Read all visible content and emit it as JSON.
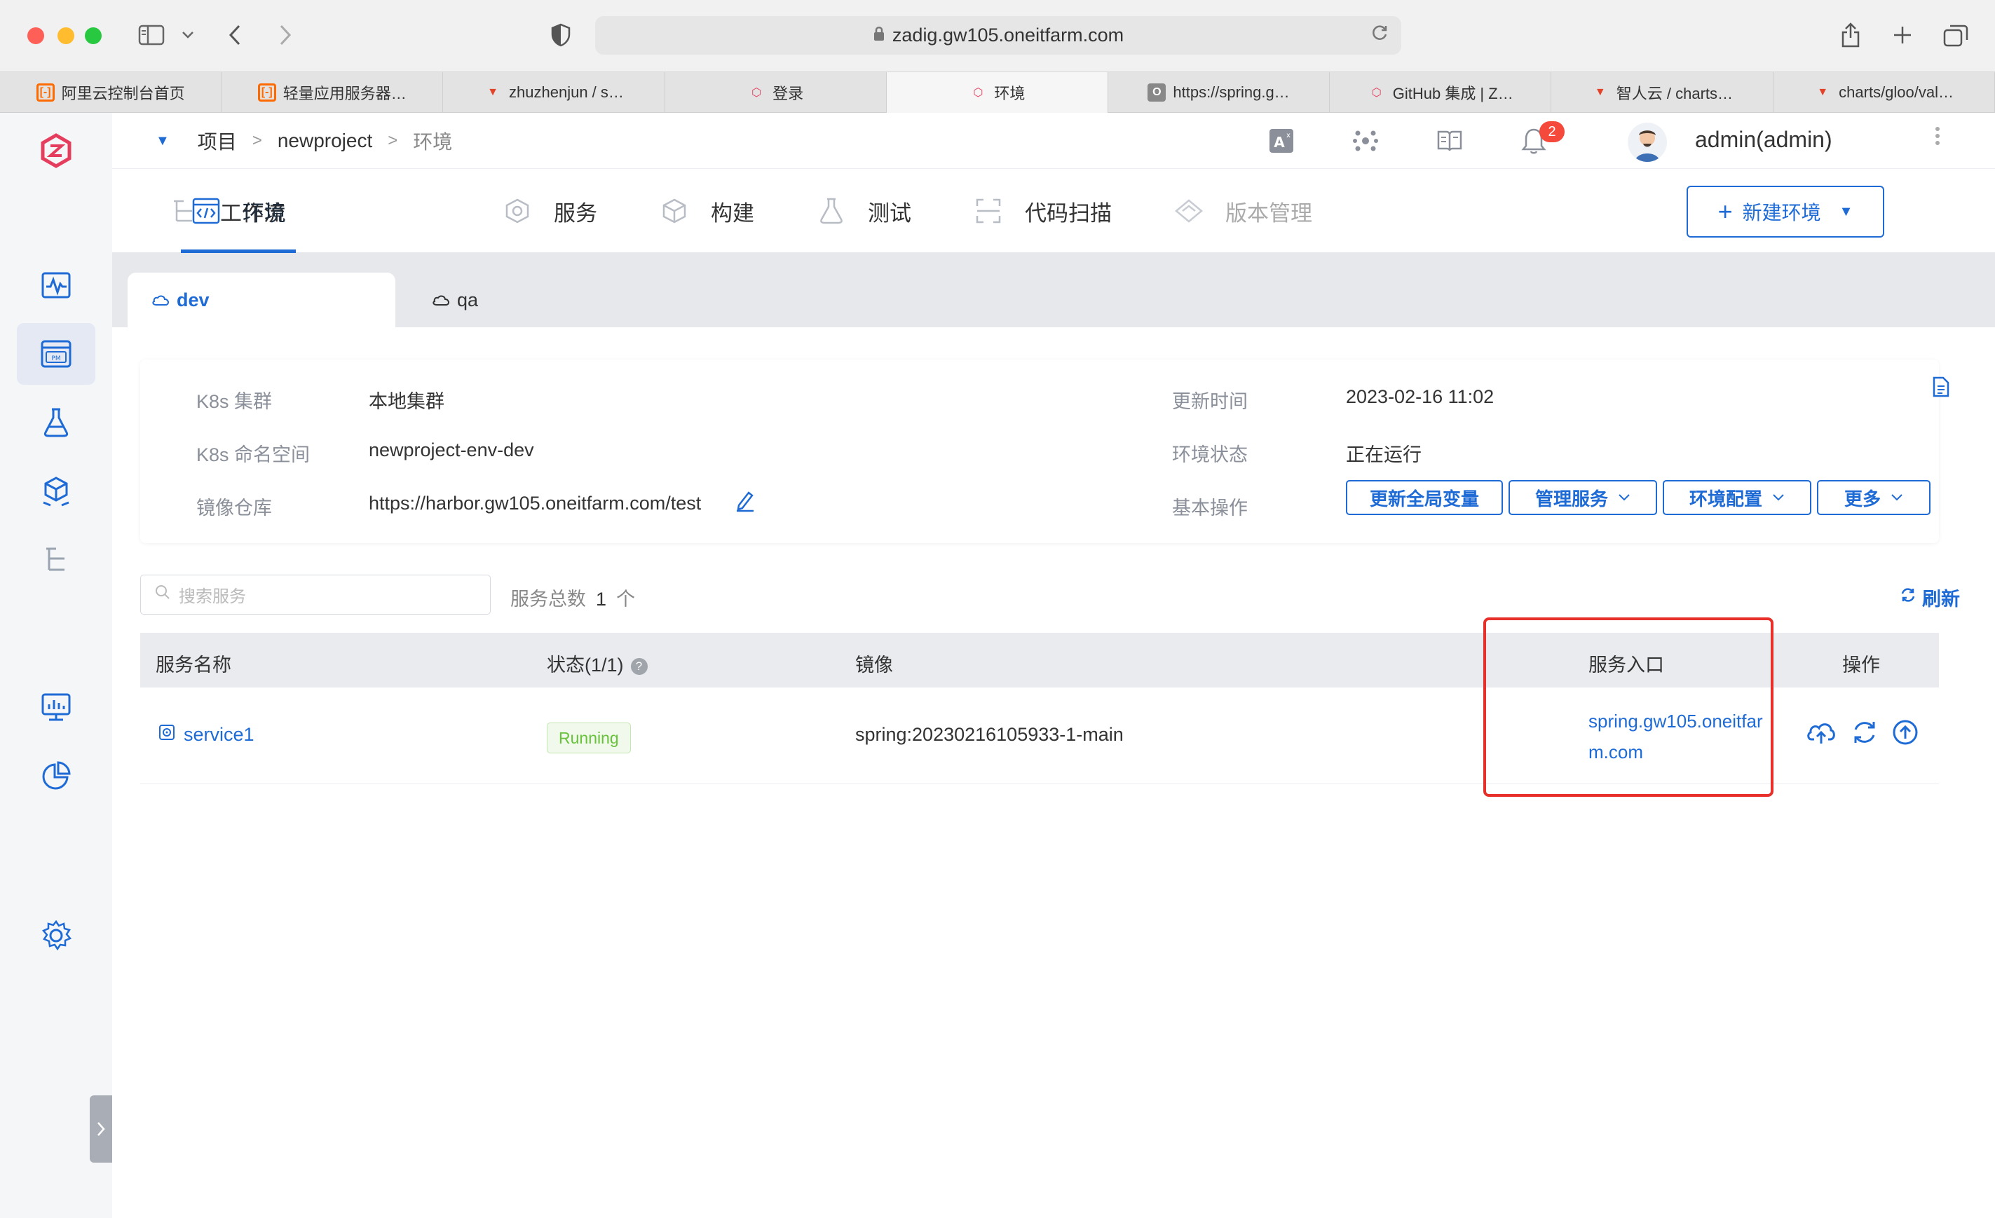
{
  "browser": {
    "url": "zadig.gw105.oneitfarm.com",
    "tabs": [
      {
        "label": "阿里云控制台首页",
        "favicon": "aliyun-icon",
        "active": false
      },
      {
        "label": "轻量应用服务器…",
        "favicon": "aliyun-icon",
        "active": false
      },
      {
        "label": "zhuzhenjun / s…",
        "favicon": "gitlab-icon",
        "active": false
      },
      {
        "label": "登录",
        "favicon": "zadig-icon",
        "active": false
      },
      {
        "label": "环境",
        "favicon": "zadig-icon",
        "active": true
      },
      {
        "label": "https://spring.g…",
        "favicon": "o-icon",
        "active": false
      },
      {
        "label": "GitHub 集成 | Z…",
        "favicon": "zadig-icon",
        "active": false
      },
      {
        "label": "智人云 / charts…",
        "favicon": "gitlab-icon",
        "active": false
      },
      {
        "label": "charts/gloo/val…",
        "favicon": "gitlab-icon",
        "active": false
      }
    ]
  },
  "header": {
    "breadcrumb": [
      "项目",
      "newproject",
      "环境"
    ],
    "notification_count": "2",
    "username": "admin(admin)"
  },
  "module_tabs": [
    {
      "label": "工作流",
      "icon": "workflow-icon",
      "state": "normal"
    },
    {
      "label": "环境",
      "icon": "code-env-icon",
      "state": "active"
    },
    {
      "label": "服务",
      "icon": "service-icon",
      "state": "normal"
    },
    {
      "label": "构建",
      "icon": "build-icon",
      "state": "normal"
    },
    {
      "label": "测试",
      "icon": "flask-icon",
      "state": "normal"
    },
    {
      "label": "代码扫描",
      "icon": "scan-icon",
      "state": "normal"
    },
    {
      "label": "版本管理",
      "icon": "version-icon",
      "state": "disabled"
    }
  ],
  "new_env_button": "新建环境",
  "env_tabs": [
    {
      "label": "dev",
      "active": true
    },
    {
      "label": "qa",
      "active": false
    }
  ],
  "env_info": {
    "cluster_label": "K8s 集群",
    "cluster_value": "本地集群",
    "namespace_label": "K8s 命名空间",
    "namespace_value": "newproject-env-dev",
    "registry_label": "镜像仓库",
    "registry_value": "https://harbor.gw105.oneitfarm.com/test",
    "updated_label": "更新时间",
    "updated_value": "2023-02-16 11:02",
    "status_label": "环境状态",
    "status_value": "正在运行",
    "ops_label": "基本操作",
    "ops_buttons": [
      "更新全局变量",
      "管理服务",
      "环境配置",
      "更多"
    ]
  },
  "service_list": {
    "search_placeholder": "搜索服务",
    "total_label": "服务总数",
    "total_count": "1",
    "total_unit": "个",
    "refresh_label": "刷新",
    "columns": [
      "服务名称",
      "状态(1/1)",
      "镜像",
      "服务入口",
      "操作"
    ],
    "rows": [
      {
        "name": "service1",
        "status": "Running",
        "image": "spring:20230216105933-1-main",
        "entry": "spring.gw105.oneitfarm.com"
      }
    ]
  },
  "colors": {
    "accent": "#1f6bd6",
    "running_green": "#67c23a",
    "highlight_red": "#e8302b",
    "badge_red": "#f5493b"
  }
}
